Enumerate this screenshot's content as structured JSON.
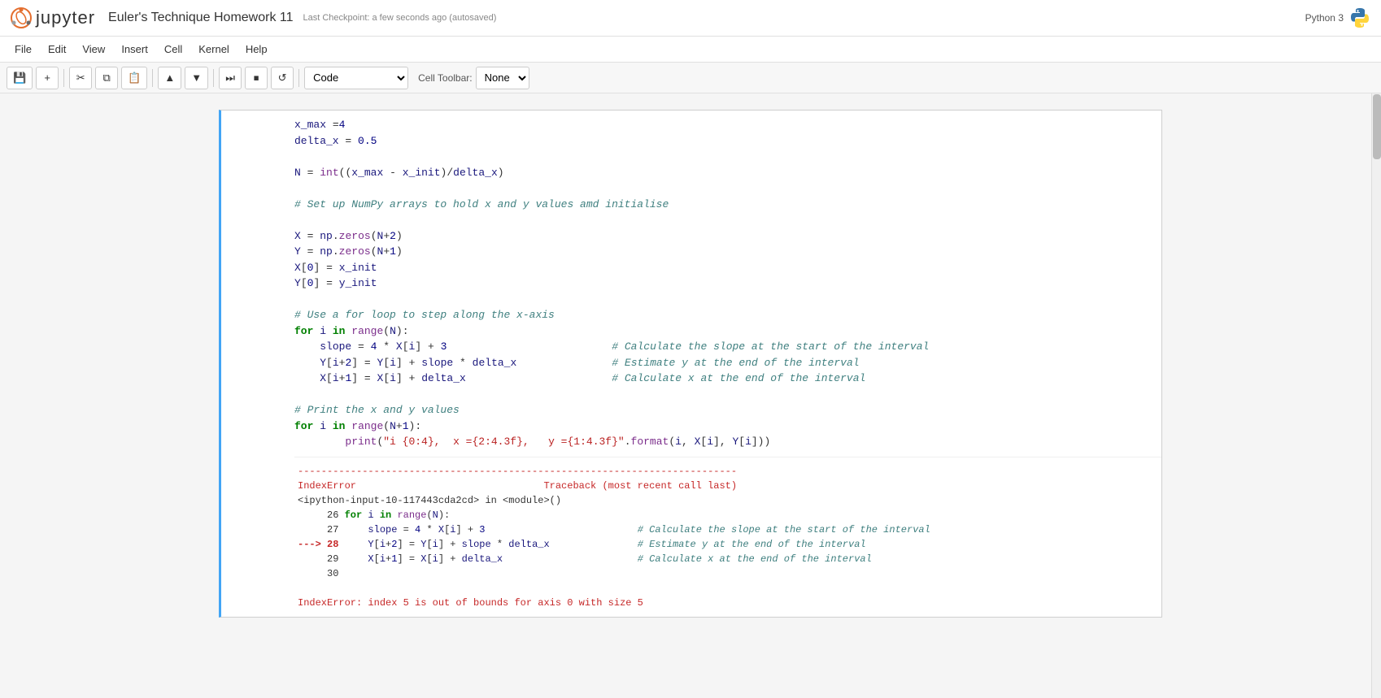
{
  "header": {
    "logo_text": "jupyter",
    "title": "Euler's Technique Homework 11",
    "checkpoint": "Last Checkpoint: a few seconds ago (autosaved)",
    "kernel": "Python 3"
  },
  "menu": {
    "items": [
      "File",
      "Edit",
      "View",
      "Insert",
      "Cell",
      "Kernel",
      "Help"
    ]
  },
  "toolbar": {
    "cell_type": "Code",
    "cell_toolbar_label": "Cell Toolbar:",
    "cell_toolbar_value": "None"
  },
  "cell": {
    "prompt": "",
    "code_lines": [
      "x_max = 4",
      "delta_x = 0.5",
      "",
      "N = int((x_max - x_init)/delta_x)",
      "",
      "# Set up NumPy arrays to hold x and y values amd initialise",
      "",
      "X = np.zeros(N+2)",
      "Y = np.zeros(N+1)",
      "X[0] = x_init",
      "Y[0] = y_init",
      "",
      "# Use a for loop to step along the x-axis",
      "for i in range(N):",
      "    slope = 4 * X[i] + 3                          # Calculate the slope at the start of the interval",
      "    Y[i+2] = Y[i] + slope * delta_x               # Estimate y at the end of the interval",
      "    X[i+1] = X[i] + delta_x                       # Calculate x at the end of the interval",
      "",
      "# Print the x and y values",
      "for i in range(N+1):",
      "        print(\"i {0:4},  x ={2:4.3f},   y ={1:4.3f}\".format(i, X[i], Y[i]))"
    ]
  },
  "error_output": {
    "separator": "-------------------------------------------------------------------------",
    "error_type": "IndexError",
    "traceback_header": "Traceback (most recent call last)",
    "location": "<ipython-input-10-117443cda2cd> in <module>()",
    "lines": [
      "     26 for i in range(N):",
      "     27     slope = 4 * X[i] + 3                          # Calculate the slope at the start of the interval",
      "---> 28     Y[i+2] = Y[i] + slope * delta_x               # Estimate y at the end of the interval",
      "     29     X[i+1] = X[i] + delta_x                       # Calculate x at the end of the interval",
      "     30"
    ],
    "error_message": "IndexError: index 5 is out of bounds for axis 0 with size 5"
  }
}
